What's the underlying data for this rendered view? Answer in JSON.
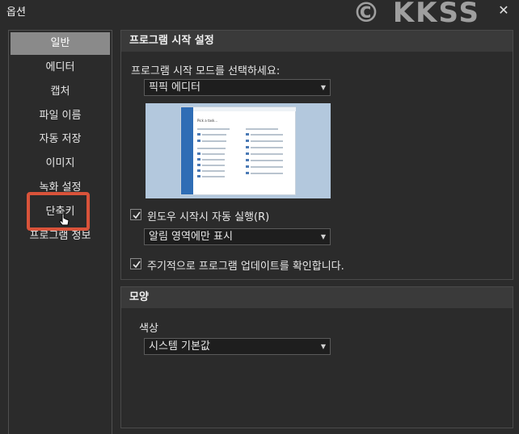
{
  "window": {
    "title": "옵션",
    "watermark": "© KKSS",
    "close_label": "✕"
  },
  "sidebar": {
    "items": [
      {
        "label": "일반",
        "active": true
      },
      {
        "label": "에디터"
      },
      {
        "label": "캡처"
      },
      {
        "label": "파일 이름"
      },
      {
        "label": "자동 저장"
      },
      {
        "label": "이미지"
      },
      {
        "label": "녹화 설정"
      },
      {
        "label": "단축키",
        "highlighted": true
      },
      {
        "label": "프로그램 정보"
      }
    ]
  },
  "startup": {
    "header": "프로그램 시작 설정",
    "mode_label": "프로그램 시작 모드를 선택하세요:",
    "mode_value": "픽픽 에디터",
    "preview_text": "Pick a task...",
    "run_on_startup": {
      "label": "윈도우 시작시 자동 실행(R)",
      "checked": true
    },
    "tray_value": "알림 영역에만 표시",
    "check_updates": {
      "label": "주기적으로 프로그램 업데이트를 확인합니다.",
      "checked": true
    }
  },
  "appearance": {
    "header": "모양",
    "color_label": "색상",
    "color_value": "시스템 기본값"
  },
  "colors": {
    "background": "#2b2b2b",
    "panel_header": "#3a3a3a",
    "active_nav": "#8a8a8a",
    "highlight": "#d9533a",
    "preview_bg": "#b3c8dd",
    "preview_sidebar": "#2f6db5"
  }
}
